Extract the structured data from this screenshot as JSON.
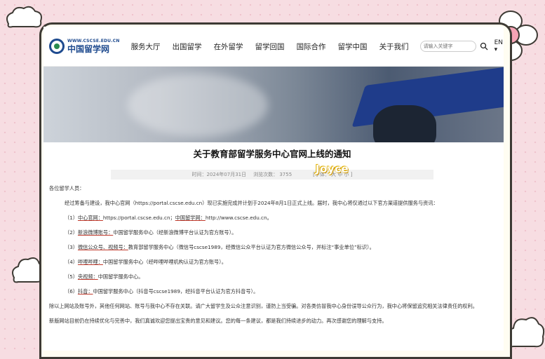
{
  "nav": {
    "logo_url": "WWW.CSCSE.EDU.CN",
    "logo_name": "中国留学网",
    "menu": [
      "服务大厅",
      "出国留学",
      "在外留学",
      "留学回国",
      "国际合作",
      "留学中国",
      "关于我们"
    ],
    "search_placeholder": "请输入关键字",
    "lang": "EN ▾"
  },
  "article": {
    "title": "关于教育部留学服务中心官网上线的通知",
    "meta_time": "时间：2024年07月31日",
    "meta_views": "浏览次数：    3755",
    "meta_font": "[字体：  大   中   小 ]",
    "watermark": "Joyce",
    "greeting": "各位留学人员：",
    "intro": "经过筹备与建设，我中心官网（https://portal.cscse.edu.cn）现已实施完成并计划于2024年8月1日正式上线。届时，我中心将仅通过以下官方渠道提供服务与资讯：",
    "items": [
      {
        "num": "（1）",
        "label": "中心官网：",
        "text": "https://portal.cscse.edu.cn；",
        "label2": "中国留学网：",
        "text2": "http://www.cscse.edu.cn。"
      },
      {
        "num": "（2）",
        "label": "新浪微博账号：",
        "text": "中国留学服务中心（经新浪微博平台认证为官方账号）。"
      },
      {
        "num": "（3）",
        "label": "微信公众号、视频号：",
        "text": "教育部留学服务中心（微信号cscse1989，经微信公众平台认证为官方微信公众号，并标注“事业单位”标识）。"
      },
      {
        "num": "（4）",
        "label": "哔哩哔哩：",
        "text": "中国留学服务中心（经哔哩哔哩机构认证为官方账号）。"
      },
      {
        "num": "（5）",
        "label": "央视频：",
        "text": "中国留学服务中心。"
      },
      {
        "num": "（6）",
        "label": "抖音：",
        "text": "中国留学服务中心（抖音号cscse1989，经抖音平台认证为官方抖音号）。"
      }
    ],
    "outro1": "除以上网站及账号外，其他任何网站、账号与我中心不存在关联。请广大留学生及公众注意识别，谨防上当受骗。对各类仿冒我中心身份误导公众行为，我中心将保留追究相关法律责任的权利。",
    "outro2": "新版网站目前仍在持续优化与完善中，我们真诚欢迎您提出宝贵的意见和建议。您的每一条建议，都是我们持续进步的动力。再次感谢您的理解与支持。"
  }
}
